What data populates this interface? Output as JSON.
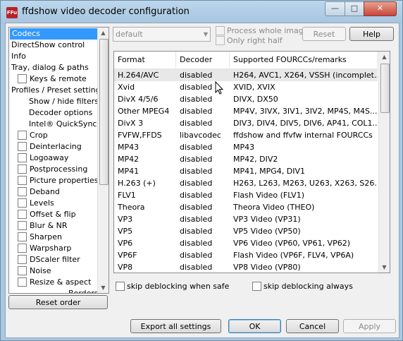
{
  "window": {
    "title": "ffdshow video decoder configuration",
    "icon_text": "FFu"
  },
  "sidebar": {
    "items": [
      {
        "label": "Codecs",
        "checkbox": false,
        "indent": 0,
        "selected": true
      },
      {
        "label": "DirectShow control",
        "checkbox": false,
        "indent": 0
      },
      {
        "label": "Info",
        "checkbox": false,
        "indent": 0
      },
      {
        "label": "Tray, dialog & paths",
        "checkbox": false,
        "indent": 0
      },
      {
        "label": "Keys & remote",
        "checkbox": true,
        "indent": 1
      },
      {
        "label": "Profiles / Preset settings",
        "checkbox": false,
        "indent": 0
      },
      {
        "label": "Show / hide filters",
        "checkbox": false,
        "indent": 2
      },
      {
        "label": "Decoder options",
        "checkbox": false,
        "indent": 2
      },
      {
        "label": "Intel® QuickSync",
        "checkbox": false,
        "indent": 2
      },
      {
        "label": "Crop",
        "checkbox": true,
        "indent": 1
      },
      {
        "label": "Deinterlacing",
        "checkbox": true,
        "indent": 1
      },
      {
        "label": "Logoaway",
        "checkbox": true,
        "indent": 1
      },
      {
        "label": "Postprocessing",
        "checkbox": true,
        "indent": 1
      },
      {
        "label": "Picture properties",
        "checkbox": true,
        "indent": 1
      },
      {
        "label": "Deband",
        "checkbox": true,
        "indent": 1
      },
      {
        "label": "Levels",
        "checkbox": true,
        "indent": 1
      },
      {
        "label": "Offset & flip",
        "checkbox": true,
        "indent": 1
      },
      {
        "label": "Blur & NR",
        "checkbox": true,
        "indent": 1
      },
      {
        "label": "Sharpen",
        "checkbox": true,
        "indent": 1
      },
      {
        "label": "Warpsharp",
        "checkbox": true,
        "indent": 1
      },
      {
        "label": "DScaler filter",
        "checkbox": true,
        "indent": 1
      },
      {
        "label": "Noise",
        "checkbox": true,
        "indent": 1
      },
      {
        "label": "Resize & aspect",
        "checkbox": true,
        "indent": 1
      },
      {
        "label": "Borders",
        "checkbox": false,
        "indent": 3
      }
    ]
  },
  "reset_order_label": "Reset order",
  "toolbar": {
    "preset_value": "default",
    "process_whole_image": "Process whole image",
    "only_right_half": "Only right half",
    "reset_label": "Reset",
    "help_label": "Help"
  },
  "codecs": {
    "columns": [
      "Format",
      "Decoder",
      "Supported FOURCCs/remarks"
    ],
    "rows": [
      [
        "H.264/AVC",
        "disabled",
        "H264, AVC1, X264, VSSH (incomplet..."
      ],
      [
        "Xvid",
        "disabled",
        "XVID, XVIX"
      ],
      [
        "DivX 4/5/6",
        "disabled",
        "DIVX, DX50"
      ],
      [
        "Other MPEG4",
        "disabled",
        "MP4V, 3IVX, 3IV1, 3IV2, MP4S, M4S..."
      ],
      [
        "DivX 3",
        "disabled",
        "DIV3, DIV4, DIV5, DIV6, AP41, COL1..."
      ],
      [
        "FVFW,FFDS",
        "libavcodec",
        "ffdshow and ffvfw internal FOURCCs"
      ],
      [
        "MP43",
        "disabled",
        "MP43"
      ],
      [
        "MP42",
        "disabled",
        "MP42, DIV2"
      ],
      [
        "MP41",
        "disabled",
        "MP41, MPG4, DIV1"
      ],
      [
        "H.263 (+)",
        "disabled",
        "H263, L263, M263, U263, X263, S26..."
      ],
      [
        "FLV1",
        "disabled",
        "Flash Video (FLV1)"
      ],
      [
        "Theora",
        "disabled",
        "Theora Video (THEO)"
      ],
      [
        "VP3",
        "disabled",
        "VP3 Video (VP31)"
      ],
      [
        "VP5",
        "disabled",
        "VP5 Video (VP50)"
      ],
      [
        "VP6",
        "disabled",
        "VP6 Video (VP60, VP61, VP62)"
      ],
      [
        "VP6F",
        "disabled",
        "Flash Video (VP6F, FLV4, VP6A)"
      ],
      [
        "VP8",
        "disabled",
        "VP8 Video (VP80)"
      ]
    ],
    "selected_row": 0
  },
  "options": {
    "skip_deblocking_safe": "skip deblocking when safe",
    "skip_deblocking_always": "skip deblocking always"
  },
  "footer": {
    "export_label": "Export all settings",
    "ok_label": "OK",
    "cancel_label": "Cancel",
    "apply_label": "Apply"
  }
}
